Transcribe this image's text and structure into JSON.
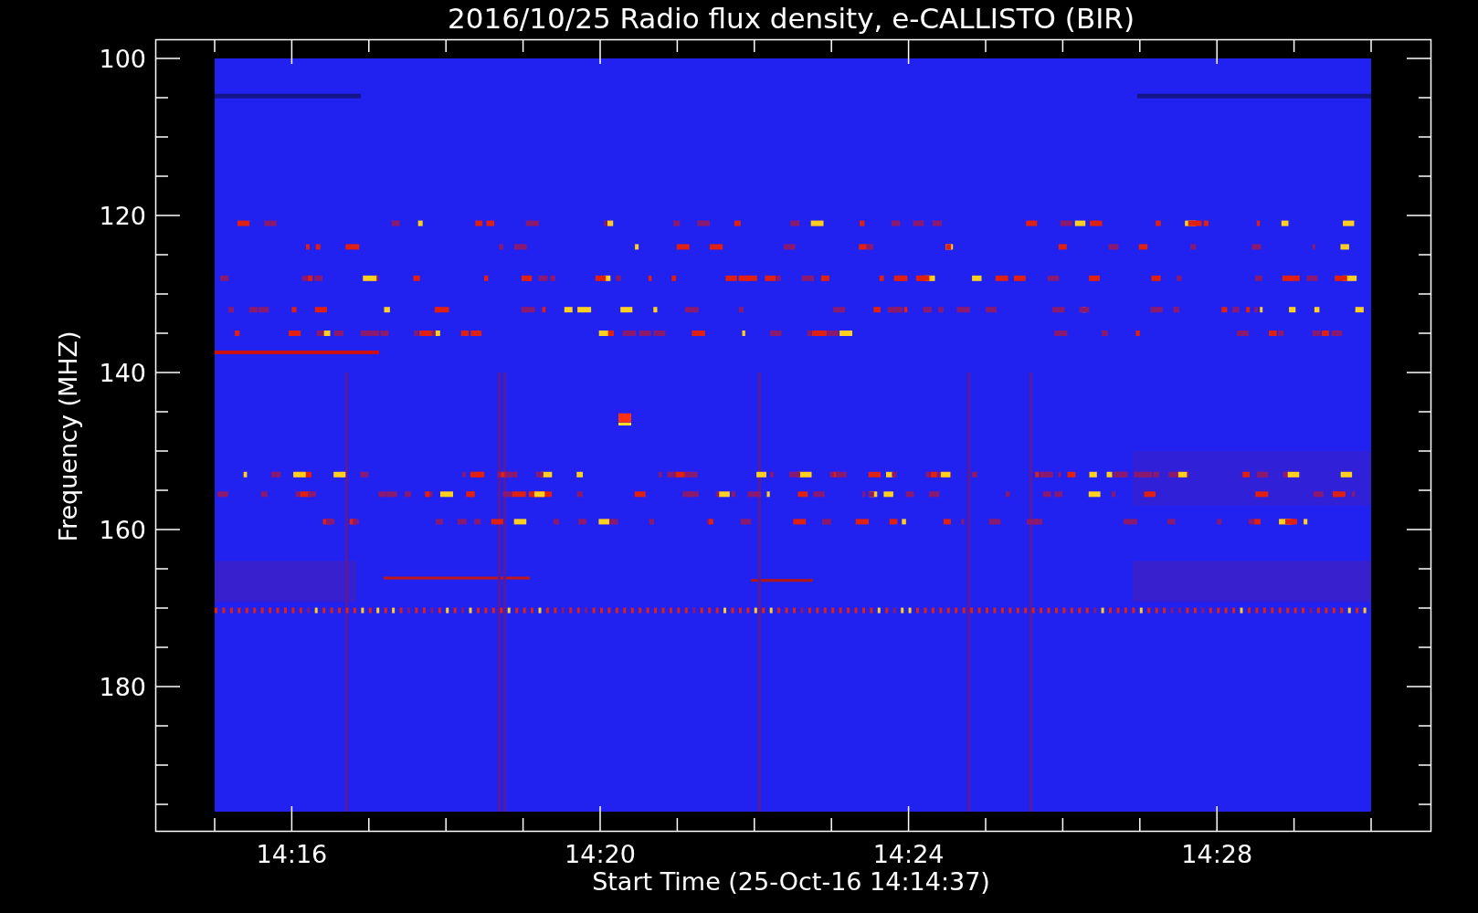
{
  "title": "2016/10/25  Radio flux density, e-CALLISTO (BIR)",
  "y_axis": {
    "label": "Frequency (MHZ)",
    "ticks": [
      "100",
      "120",
      "140",
      "160",
      "180"
    ]
  },
  "x_axis": {
    "label": "Start Time (25-Oct-16 14:14:37)",
    "ticks": [
      "14:16",
      "14:20",
      "14:24",
      "14:28"
    ]
  }
}
